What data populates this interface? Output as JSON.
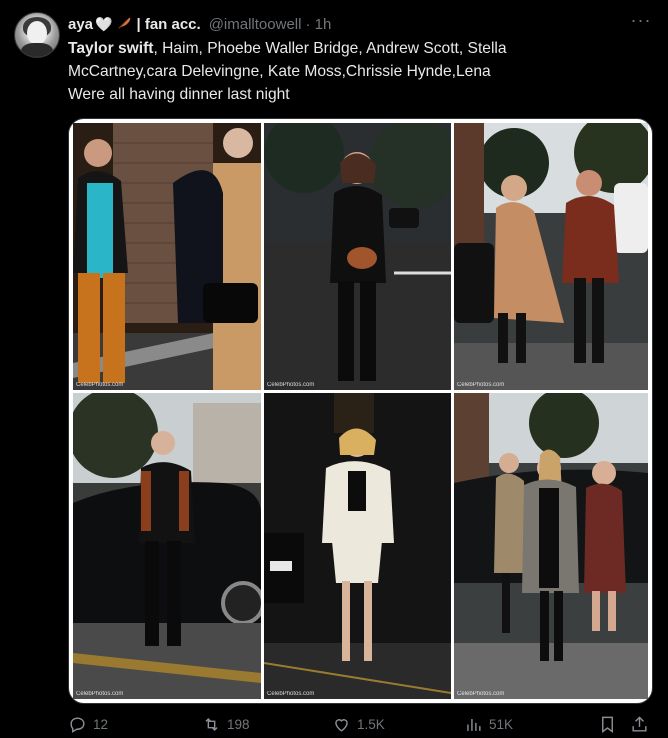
{
  "post": {
    "author_name": "aya",
    "author_suffix": "| fan acc.",
    "handle": "@imalltoowell",
    "time": "· 1h",
    "text_bold": "Taylor swift",
    "text_line1_rest": ", Haim, Phoebe Waller Bridge, Andrew Scott, Stella",
    "text_line2": "McCartney,cara Delevingne, Kate Moss,Chrissie Hynde,Lena",
    "text_line3": "Were all having dinner last night"
  },
  "media": {
    "photo_count": 6,
    "credit": "CelebPhotos.com"
  },
  "actions": {
    "replies": "12",
    "reposts": "198",
    "likes": "1.5K",
    "views": "51K"
  },
  "icons": [
    "avatar",
    "white-heart-icon",
    "feather-icon",
    "more-icon",
    "reply-icon",
    "repost-icon",
    "like-icon",
    "views-icon",
    "bookmark-icon",
    "share-icon"
  ],
  "colors": {
    "background": "#000000",
    "text": "#e7e9ea",
    "muted": "#71767b"
  }
}
